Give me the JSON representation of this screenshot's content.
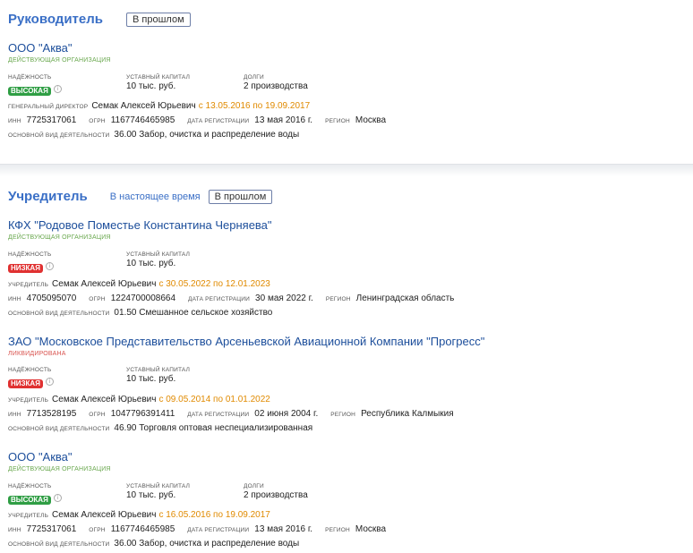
{
  "manager_section": {
    "title": "Руководитель",
    "tab_past": "В прошлом",
    "org": {
      "name": "ООО \"Аква\"",
      "status": "ДЕЙСТВУЮЩАЯ ОРГАНИЗАЦИЯ",
      "reliability_label": "НАДЁЖНОСТЬ",
      "reliability_value": "ВЫСОКАЯ",
      "capital_label": "УСТАВНЫЙ КАПИТАЛ",
      "capital_value": "10 тыс. руб.",
      "debts_label": "ДОЛГИ",
      "debts_value": "2 производства",
      "role_label": "ГЕНЕРАЛЬНЫЙ ДИРЕКТОР",
      "person": "Семак Алексей Юрьевич",
      "period": "с 13.05.2016 по 19.09.2017",
      "inn_label": "ИНН",
      "inn": "7725317061",
      "ogrn_label": "ОГРН",
      "ogrn": "1167746465985",
      "reg_date_label": "ДАТА РЕГИСТРАЦИИ",
      "reg_date": "13 мая 2016 г.",
      "region_label": "РЕГИОН",
      "region": "Москва",
      "activity_label": "ОСНОВНОЙ ВИД ДЕЯТЕЛЬНОСТИ",
      "activity": "36.00 Забор, очистка и распределение воды"
    }
  },
  "founder_section": {
    "title": "Учредитель",
    "tab_current": "В настоящее время",
    "tab_past": "В прошлом",
    "orgs": [
      {
        "name": "КФХ \"Родовое Поместье Константина Черняева\"",
        "status": "ДЕЙСТВУЮЩАЯ ОРГАНИЗАЦИЯ",
        "reliability_label": "НАДЁЖНОСТЬ",
        "reliability_value": "НИЗКАЯ",
        "capital_label": "УСТАВНЫЙ КАПИТАЛ",
        "capital_value": "10 тыс. руб.",
        "role_label": "УЧРЕДИТЕЛЬ",
        "person": "Семак Алексей Юрьевич",
        "period": "с 30.05.2022 по 12.01.2023",
        "inn_label": "ИНН",
        "inn": "4705095070",
        "ogrn_label": "ОГРН",
        "ogrn": "1224700008664",
        "reg_date_label": "ДАТА РЕГИСТРАЦИИ",
        "reg_date": "30 мая 2022 г.",
        "region_label": "РЕГИОН",
        "region": "Ленинградская область",
        "activity_label": "ОСНОВНОЙ ВИД ДЕЯТЕЛЬНОСТИ",
        "activity": "01.50 Смешанное сельское хозяйство"
      },
      {
        "name": "ЗАО \"Московское Представительство Арсеньевской Авиационной Компании \"Прогресс\"",
        "status": "ЛИКВИДИРОВАНА",
        "reliability_label": "НАДЁЖНОСТЬ",
        "reliability_value": "НИЗКАЯ",
        "capital_label": "УСТАВНЫЙ КАПИТАЛ",
        "capital_value": "10 тыс. руб.",
        "role_label": "УЧРЕДИТЕЛЬ",
        "person": "Семак Алексей Юрьевич",
        "period": "с 09.05.2014 по 01.01.2022",
        "inn_label": "ИНН",
        "inn": "7713528195",
        "ogrn_label": "ОГРН",
        "ogrn": "1047796391411",
        "reg_date_label": "ДАТА РЕГИСТРАЦИИ",
        "reg_date": "02 июня 2004 г.",
        "region_label": "РЕГИОН",
        "region": "Республика Калмыкия",
        "activity_label": "ОСНОВНОЙ ВИД ДЕЯТЕЛЬНОСТИ",
        "activity": "46.90 Торговля оптовая неспециализированная"
      },
      {
        "name": "ООО \"Аква\"",
        "status": "ДЕЙСТВУЮЩАЯ ОРГАНИЗАЦИЯ",
        "reliability_label": "НАДЁЖНОСТЬ",
        "reliability_value": "ВЫСОКАЯ",
        "capital_label": "УСТАВНЫЙ КАПИТАЛ",
        "capital_value": "10 тыс. руб.",
        "debts_label": "ДОЛГИ",
        "debts_value": "2 производства",
        "role_label": "УЧРЕДИТЕЛЬ",
        "person": "Семак Алексей Юрьевич",
        "period": "с 16.05.2016 по 19.09.2017",
        "inn_label": "ИНН",
        "inn": "7725317061",
        "ogrn_label": "ОГРН",
        "ogrn": "1167746465985",
        "reg_date_label": "ДАТА РЕГИСТРАЦИИ",
        "reg_date": "13 мая 2016 г.",
        "region_label": "РЕГИОН",
        "region": "Москва",
        "activity_label": "ОСНОВНОЙ ВИД ДЕЯТЕЛЬНОСТИ",
        "activity": "36.00 Забор, очистка и распределение воды"
      }
    ]
  },
  "colors": {
    "accent": "#3a6fc6",
    "link": "#1c4e9b",
    "period": "#e08a00",
    "high": "#2f9e44",
    "low": "#e03131"
  },
  "icons": [
    "info-icon"
  ]
}
